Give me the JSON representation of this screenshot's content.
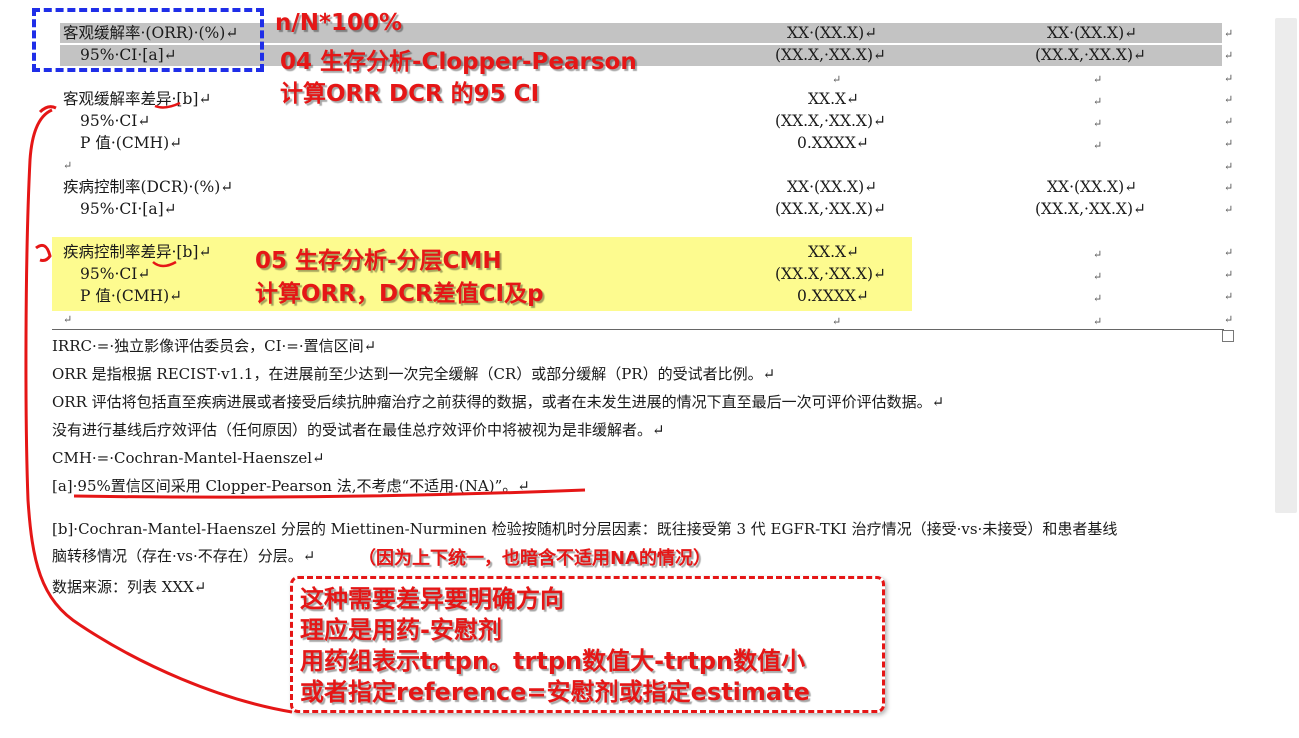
{
  "table": {
    "rows": [
      {
        "label": "客观缓解率·(ORR)·(%)↵",
        "col1": "XX·(XX.X)↵",
        "col2": "XX·(XX.X)↵"
      },
      {
        "label": "95%·CI·[a]↵",
        "col1": "(XX.X,·XX.X)↵",
        "col2": "(XX.X,·XX.X)↵"
      },
      {
        "label": "",
        "col1": "↵",
        "col2": "↵"
      },
      {
        "label": "客观缓解率差异·[b]↵",
        "col1": "XX.X↵",
        "col2": "↵"
      },
      {
        "label": "95%·CI↵",
        "col1": "(XX.X,·XX.X)↵",
        "col2": "↵"
      },
      {
        "label": "P 值·(CMH)↵",
        "col1": "0.XXXX↵",
        "col2": "↵"
      },
      {
        "label": "↵",
        "col1": "",
        "col2": ""
      },
      {
        "label": "疾病控制率(DCR)·(%)↵",
        "col1": "XX·(XX.X)↵",
        "col2": "XX·(XX.X)↵"
      },
      {
        "label": "95%·CI·[a]↵",
        "col1": "(XX.X,·XX.X)↵",
        "col2": "(XX.X,·XX.X)↵"
      },
      {
        "label": "疾病控制率差异·[b]↵",
        "col1": "XX.X↵",
        "col2": "↵"
      },
      {
        "label": "95%·CI↵",
        "col1": "(XX.X,·XX.X)↵",
        "col2": "↵"
      },
      {
        "label": "P 值·(CMH)↵",
        "col1": "0.XXXX↵",
        "col2": "↵"
      },
      {
        "label": "↵",
        "col1": "↵",
        "col2": "↵"
      }
    ],
    "cell_markers": [
      "↵",
      "↵",
      "↵",
      "↵",
      "↵",
      "↵",
      "↵",
      "↵",
      "↵",
      "↵",
      "↵",
      "↵",
      "↵"
    ]
  },
  "footnotes": [
    "IRRC·=·独立影像评估委员会，CI·=·置信区间↵",
    "ORR 是指根据 RECIST·v1.1，在进展前至少达到一次完全缓解（CR）或部分缓解（PR）的受试者比例。↵",
    "ORR 评估将包括直至疾病进展或者接受后续抗肿瘤治疗之前获得的数据，或者在未发生进展的情况下直至最后一次可评价评估数据。↵",
    "没有进行基线后疗效评估（任何原因）的受试者在最佳总疗效评价中将被视为是非缓解者。↵",
    "CMH·=·Cochran-Mantel-Haenszel↵",
    "[a]·95%置信区间采用 Clopper-Pearson 法,不考虑“不适用·(NA)”。↵"
  ],
  "footnote_b_line1": "[b]·Cochran-Mantel-Haenszel 分层的 Miettinen-Nurminen 检验按随机时分层因素：既往接受第 3 代 EGFR-TKI 治疗情况（接受·vs·未接受）和患者基线",
  "footnote_b_line2": "脑转移情况（存在·vs·不存在）分层。↵",
  "footnote_b_annotation": "（因为上下统一，也暗含不适用NA的情况）",
  "data_source": "数据来源：列表 XXX↵",
  "annotations": {
    "formula": "n/N*100%",
    "clopper_line1": "04 生存分析-Clopper-Pearson",
    "clopper_line2": "计算ORR DCR 的95 CI",
    "cmh_line1": "05 生存分析-分层CMH",
    "cmh_line2": "计算ORR，DCR差值CI及p",
    "box_lines": [
      "这种需要差异要明确方向",
      "理应是用药-安慰剂",
      "用药组表示trtpn。trtpn数值大-trtpn数值小",
      "或者指定reference=安慰剂或指定estimate"
    ]
  },
  "colors": {
    "annotation_red": "#e51616",
    "highlight_gray": "#c3c3c3",
    "highlight_yellow": "#fdfb8f",
    "dashed_blue": "#1f2ee8"
  }
}
